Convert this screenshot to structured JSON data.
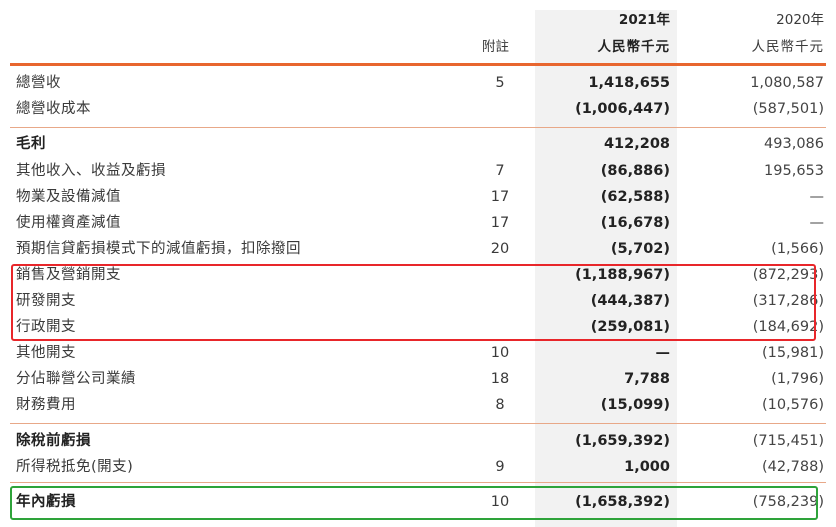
{
  "header": {
    "note_label": "附註",
    "year_2021": "2021年",
    "unit_2021": "人民幣千元",
    "year_2020": "2020年",
    "unit_2020": "人民幣千元"
  },
  "rows": [
    {
      "label": "總營收",
      "note": "5",
      "v2021": "1,418,655",
      "v2020": "1,080,587",
      "bold": false
    },
    {
      "label": "總營收成本",
      "note": "",
      "v2021": "(1,006,447)",
      "v2020": "(587,501)",
      "bold": false
    },
    {
      "label": "毛利",
      "note": "",
      "v2021": "412,208",
      "v2020": "493,086",
      "bold": true
    },
    {
      "label": "其他收入、收益及虧損",
      "note": "7",
      "v2021": "(86,886)",
      "v2020": "195,653",
      "bold": false
    },
    {
      "label": "物業及設備減值",
      "note": "17",
      "v2021": "(62,588)",
      "v2020": "—",
      "bold": false
    },
    {
      "label": "使用權資產減值",
      "note": "17",
      "v2021": "(16,678)",
      "v2020": "—",
      "bold": false
    },
    {
      "label": "預期信貸虧損模式下的減值虧損，扣除撥回",
      "note": "20",
      "v2021": "(5,702)",
      "v2020": "(1,566)",
      "bold": false
    },
    {
      "label": "銷售及營銷開支",
      "note": "",
      "v2021": "(1,188,967)",
      "v2020": "(872,293)",
      "bold": false
    },
    {
      "label": "研發開支",
      "note": "",
      "v2021": "(444,387)",
      "v2020": "(317,286)",
      "bold": false
    },
    {
      "label": "行政開支",
      "note": "",
      "v2021": "(259,081)",
      "v2020": "(184,692)",
      "bold": false
    },
    {
      "label": "其他開支",
      "note": "10",
      "v2021": "—",
      "v2020": "(15,981)",
      "bold": false
    },
    {
      "label": "分佔聯營公司業績",
      "note": "18",
      "v2021": "7,788",
      "v2020": "(1,796)",
      "bold": false
    },
    {
      "label": "財務費用",
      "note": "8",
      "v2021": "(15,099)",
      "v2020": "(10,576)",
      "bold": false
    },
    {
      "label": "除稅前虧損",
      "note": "",
      "v2021": "(1,659,392)",
      "v2020": "(715,451)",
      "bold": true
    },
    {
      "label": "所得税抵免(開支)",
      "note": "9",
      "v2021": "1,000",
      "v2020": "(42,788)",
      "bold": false
    },
    {
      "label": "年內虧損",
      "note": "10",
      "v2021": "(1,658,392)",
      "v2020": "(758,239)",
      "bold": true
    }
  ],
  "colors": {
    "accent_line": "#e8662f",
    "highlight_red": "#e8262a",
    "highlight_green": "#2ea33a",
    "column_shade": "#f2f2f2"
  }
}
